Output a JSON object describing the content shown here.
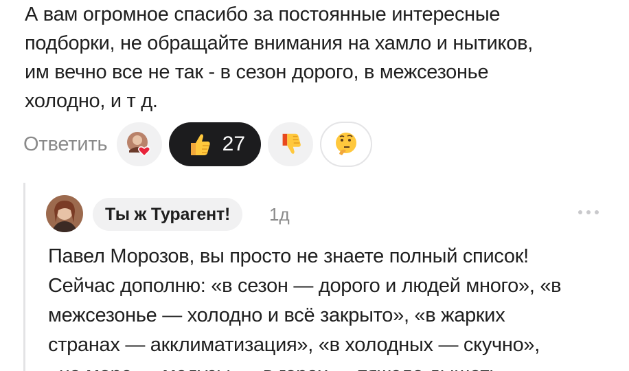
{
  "comment": {
    "lines": [
      "А вам огромное спасибо за постоянные интересные",
      "подборки, не обращайте внимания на хамло и нытиков,",
      "им вечно все не так - в сезон дорого, в межсезонье",
      "холодно, и т д."
    ]
  },
  "actions": {
    "reply_label": "Ответить",
    "reactions": [
      {
        "icon": "avatar-heart-icon"
      },
      {
        "icon": "thumbs-up-icon",
        "count": "27",
        "active": true
      },
      {
        "icon": "thumbs-down-icon"
      },
      {
        "icon": "thinking-face-icon"
      }
    ]
  },
  "reply": {
    "author": "Ты ж Турагент!",
    "time": "1д",
    "lines": [
      "Павел Морозов, вы просто не знаете полный список!",
      "Сейчас дополню: «в сезон — дорого и людей много», «в",
      "межсезонье — холодно и всё закрыто», «в жарких",
      "странах — акклиматизация», «в холодных — скучно»,",
      "«на море — медузы», «в горах — тяжело дышать»,"
    ]
  },
  "colors": {
    "text": "#1f1f1f",
    "muted": "#8a8a8a",
    "chip_bg": "#f1f1f2",
    "active_reaction_bg": "#1c1c1e"
  }
}
